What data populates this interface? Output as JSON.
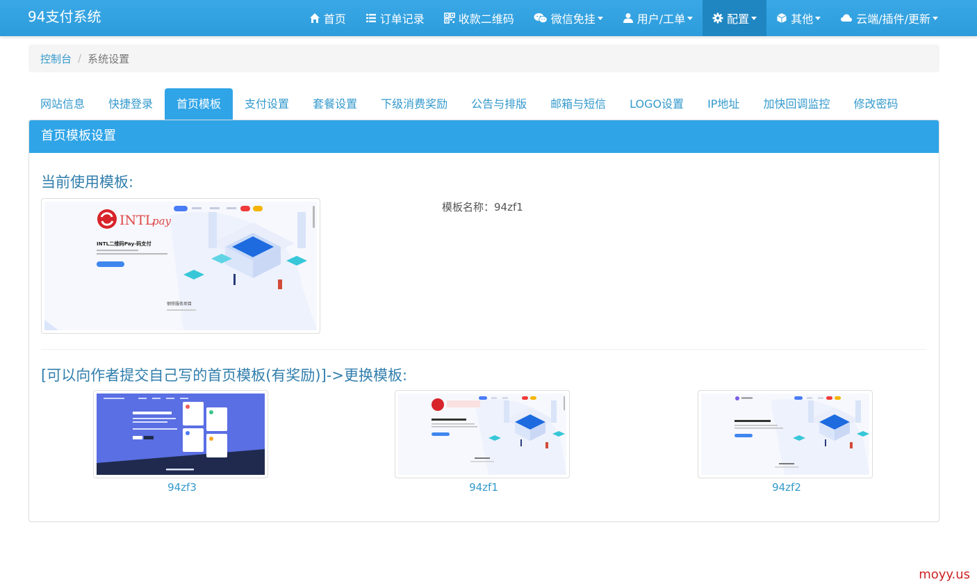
{
  "brand": "94支付系统",
  "nav": [
    {
      "label": "首页",
      "icon": "home-icon"
    },
    {
      "label": "订单记录",
      "icon": "list-icon"
    },
    {
      "label": "收款二维码",
      "icon": "qrcode-icon"
    },
    {
      "label": "微信免挂",
      "icon": "wechat-icon",
      "dropdown": true
    },
    {
      "label": "用户/工单",
      "icon": "user-icon",
      "dropdown": true
    },
    {
      "label": "配置",
      "icon": "gear-icon",
      "dropdown": true,
      "active": true
    },
    {
      "label": "其他",
      "icon": "cube-icon",
      "dropdown": true
    },
    {
      "label": "云端/插件/更新",
      "icon": "cloud-icon",
      "dropdown": true
    }
  ],
  "breadcrumb": {
    "home": "控制台",
    "separator": "/",
    "current": "系统设置"
  },
  "tabs": [
    "网站信息",
    "快捷登录",
    "首页模板",
    "支付设置",
    "套餐设置",
    "下级消费奖励",
    "公告与排版",
    "邮箱与短信",
    "LOGO设置",
    "IP地址",
    "加快回调监控",
    "修改密码"
  ],
  "active_tab": 2,
  "panel": {
    "title": "首页模板设置",
    "current_heading": "当前使用模板:",
    "current_template_label": "模板名称：94zf1",
    "preview_logo_text": "INTL",
    "preview_logo_suffix": "pay",
    "preview_headline": "INTL二维码Pay-码支付",
    "preview_footer_text": "钢铁服务项目",
    "change_heading": "[可以向作者提交自己写的首页模板(有奖励)]->更换模板:",
    "templates": [
      {
        "name": "94zf3",
        "style": "blue"
      },
      {
        "name": "94zf1",
        "style": "light"
      },
      {
        "name": "94zf2",
        "style": "light-alt"
      }
    ]
  },
  "watermark": "moyy.us",
  "colors": {
    "primary": "#2fa4e7",
    "nav_active": "#1f86c2",
    "link": "#3399cc",
    "heading": "#317eac",
    "watermark": "#cc2222"
  }
}
